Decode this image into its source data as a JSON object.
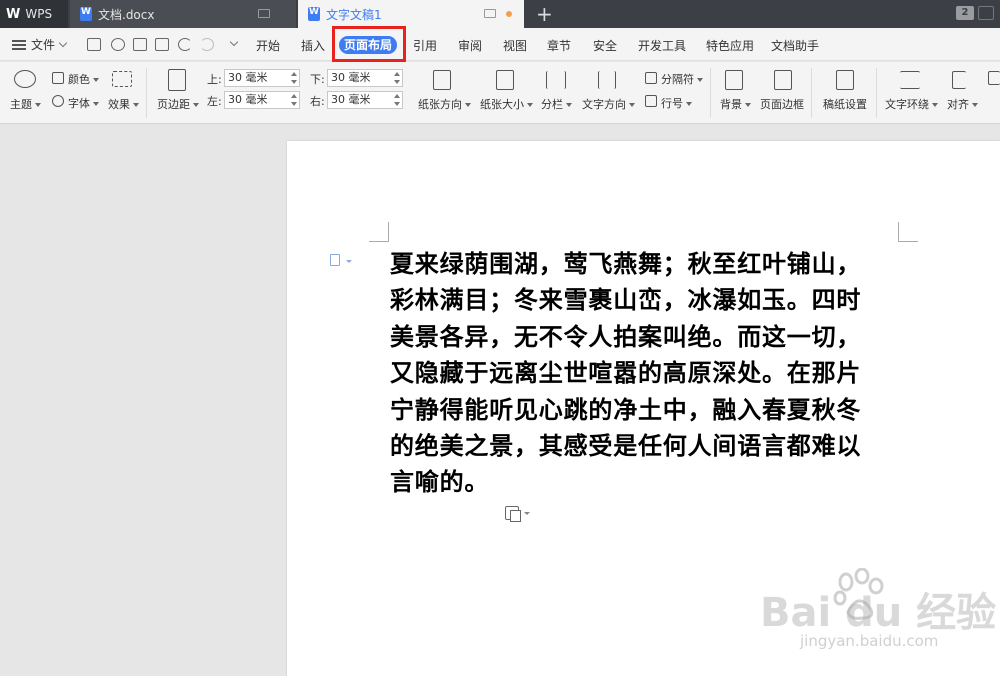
{
  "tabs": [
    {
      "label": "WPS",
      "logo": "W"
    },
    {
      "label": "文档.docx"
    },
    {
      "label": "文字文稿1",
      "modified": true
    }
  ],
  "window_count": "2",
  "menu": {
    "file": "文件",
    "items": [
      "开始",
      "插入",
      "页面布局",
      "引用",
      "审阅",
      "视图",
      "章节",
      "安全",
      "开发工具",
      "特色应用",
      "文档助手"
    ],
    "active": "页面布局"
  },
  "ribbon": {
    "theme": "主题",
    "color": "颜色",
    "font": "字体",
    "effect": "效果",
    "margins": "页边距",
    "margin_top_label": "上:",
    "margin_bottom_label": "下:",
    "margin_left_label": "左:",
    "margin_right_label": "右:",
    "margin_top": "30 毫米",
    "margin_bottom": "30 毫米",
    "margin_left": "30 毫米",
    "margin_right": "30 毫米",
    "orientation": "纸张方向",
    "size": "纸张大小",
    "columns": "分栏",
    "text_direction": "文字方向",
    "separator": "分隔符",
    "line_numbers": "行号",
    "background": "背景",
    "page_border": "页面边框",
    "manuscript": "稿纸设置",
    "text_wrap": "文字环绕",
    "align": "对齐"
  },
  "document": {
    "lines": [
      "夏来绿荫围湖，莺飞燕舞；秋至红叶铺山，",
      "彩林满目；冬来雪裹山峦，冰瀑如玉。四时",
      "美景各异，无不令人拍案叫绝。而这一切，",
      "又隐藏于远离尘世喧嚣的高原深处。在那片",
      "宁静得能听见心跳的净土中，融入春夏秋冬",
      "的绝美之景，其感受是任何人间语言都难以",
      "言喻的。"
    ]
  },
  "watermark": {
    "brand": "Bai du 经验",
    "url": "jingyan.baidu.com"
  }
}
